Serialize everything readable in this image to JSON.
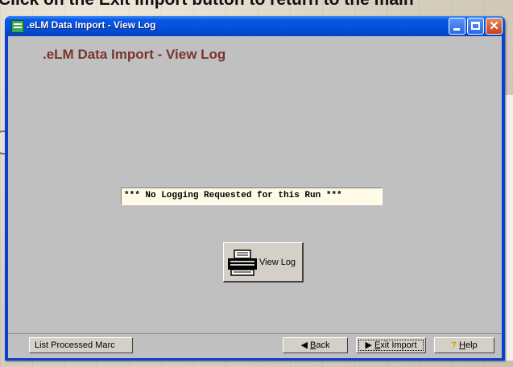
{
  "backdrop": {
    "caption": "Click on the Exit Import button to return to the main"
  },
  "window": {
    "title": ".eLM Data Import - View Log",
    "controls": {
      "minimize_icon": "minimize-icon",
      "maximize_icon": "maximize-icon",
      "close_glyph": "✕"
    }
  },
  "main": {
    "heading": ".eLM Data Import - View Log",
    "log_message": "*** No Logging Requested for this Run ***",
    "view_log_button": {
      "label": "View Log",
      "icon": "printer-icon"
    }
  },
  "statusbar": {
    "list_processed": "List Processed Marc",
    "back": {
      "accel": "B",
      "rest": "ack",
      "icon": "back-arrow-icon",
      "glyph": "◀"
    },
    "exit_import": {
      "accel": "E",
      "rest": "xit Import",
      "icon": "exit-arrow-icon",
      "glyph": "▶"
    },
    "help": {
      "accel": "H",
      "rest": "elp",
      "icon": "help-icon",
      "glyph": "?"
    }
  },
  "colors": {
    "titlebar": "#0450d8",
    "client_bg": "#c0c0c0",
    "heading": "#7a3430",
    "log_bg": "#fffbe6"
  }
}
